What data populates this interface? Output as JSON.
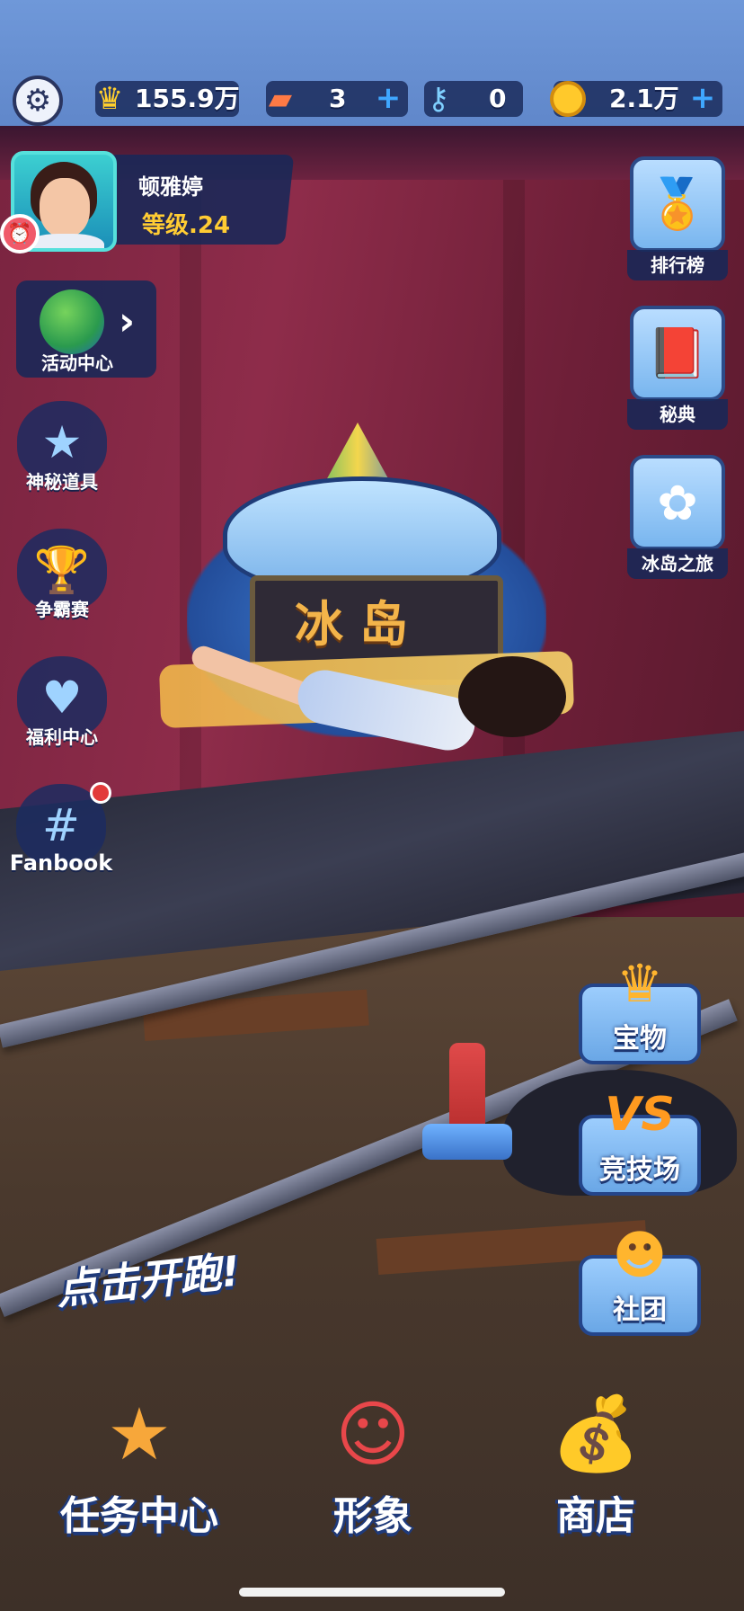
{
  "topbar": {
    "score": "155.9万",
    "boards": "3",
    "keys": "0",
    "coins": "2.1万"
  },
  "player": {
    "name": "顿雅婷",
    "level": "等级.24"
  },
  "left_menu": {
    "event_center": "活动中心",
    "mystery_items": "神秘道具",
    "championship": "争霸赛",
    "welfare_center": "福利中心",
    "fanbook": "Fanbook"
  },
  "right_menu": {
    "leaderboard": "排行榜",
    "secret_book": "秘典",
    "ice_island_trip": "冰岛之旅"
  },
  "logo": {
    "title": "冰岛"
  },
  "right_buttons": {
    "treasure": "宝物",
    "arena": "竞技场",
    "club": "社团"
  },
  "tap_to_run": "点击开跑!",
  "bottom_buttons": {
    "missions": "任务中心",
    "appearance": "形象",
    "shop": "商店"
  },
  "colors": {
    "panel": "#182858",
    "accent_blue": "#3fa7ff",
    "level_gold": "#ffcc33",
    "notification_red": "#e23a3a"
  }
}
